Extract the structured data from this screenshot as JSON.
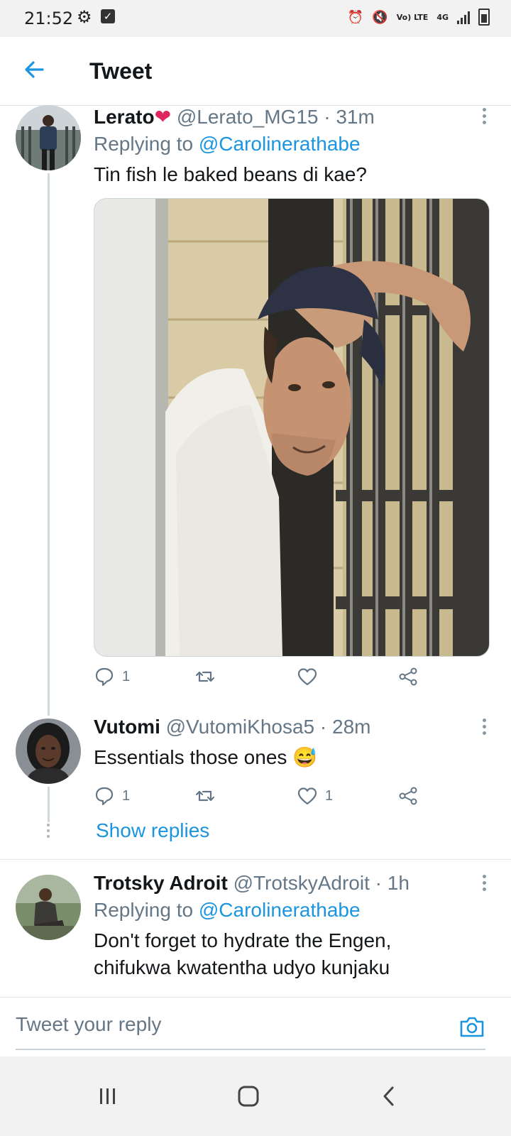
{
  "status_bar": {
    "time": "21:52",
    "volte_label": "Vo) LTE",
    "network_label": "4G"
  },
  "header": {
    "title": "Tweet"
  },
  "tweets": [
    {
      "display_name": "Lerato",
      "handle": "@Lerato_MG15",
      "separator": "·",
      "time": "31m",
      "replying_prefix": "Replying to",
      "replying_to": "@Carolinerathabe",
      "text": "Tin fish le baked beans di kae?",
      "reply_count": "1",
      "retweet_count": "",
      "like_count": ""
    },
    {
      "display_name": "Vutomi",
      "handle": "@VutomiKhosa5",
      "separator": "·",
      "time": "28m",
      "text": "Essentials those ones",
      "emoji": "😅",
      "reply_count": "1",
      "retweet_count": "",
      "like_count": "1",
      "show_replies": "Show replies"
    },
    {
      "display_name": "Trotsky Adroit",
      "handle": "@TrotskyAdroit",
      "separator": "·",
      "time": "1h",
      "replying_prefix": "Replying to",
      "replying_to": "@Carolinerathabe",
      "text_line1": "Don't forget to hydrate the Engen,",
      "text_line2": "chifukwa kwatentha udyo kunjaku"
    }
  ],
  "compose": {
    "placeholder": "Tweet your reply"
  },
  "colors": {
    "accent": "#1b95e0",
    "secondary_text": "#657786",
    "primary_text": "#14171a",
    "heart": "#e0245e"
  },
  "icons": [
    "back-arrow-icon",
    "reply-icon",
    "retweet-icon",
    "like-icon",
    "share-icon",
    "more-icon",
    "camera-icon",
    "recents-icon",
    "home-icon",
    "nav-back-icon"
  ]
}
